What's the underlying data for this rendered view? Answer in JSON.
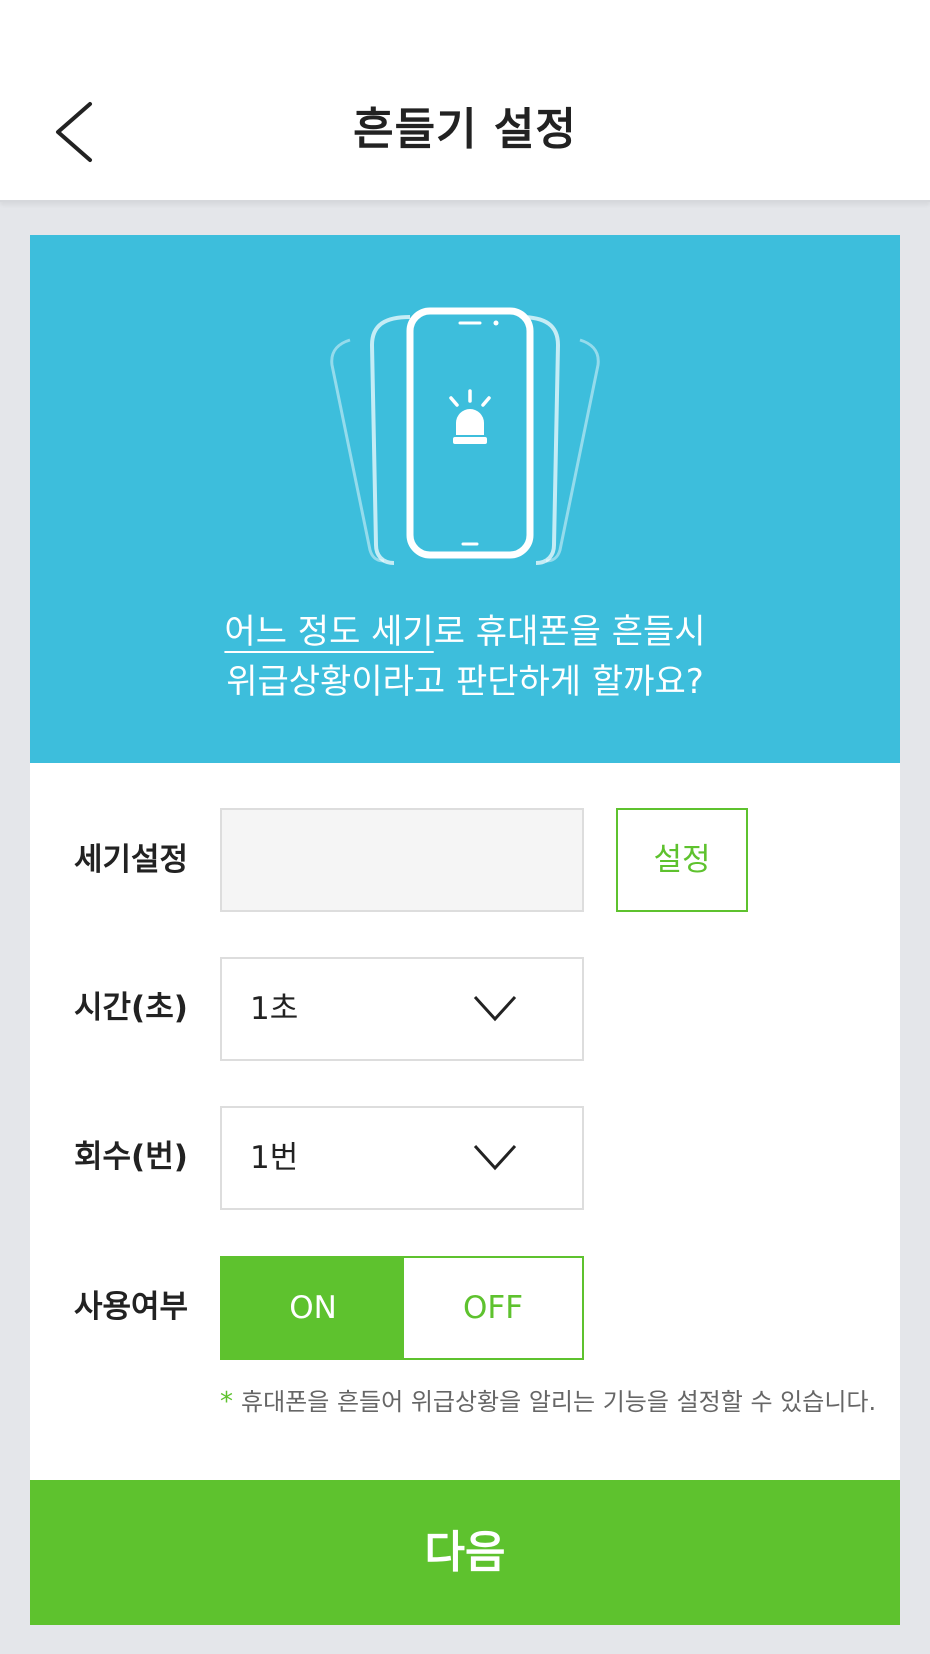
{
  "header": {
    "title": "흔들기 설정",
    "back_icon": "chevron-left-icon"
  },
  "hero": {
    "illustration_icon": "shaking-phone-alarm-icon",
    "line1_underlined": "어느 정도 세기",
    "line1_rest": "로 휴대폰을 흔들시",
    "line2": "위급상황이라고 판단하게 할까요?",
    "background_color": "#3dbedc"
  },
  "form": {
    "strength": {
      "label": "세기설정",
      "value": "",
      "button_label": "설정"
    },
    "time": {
      "label": "시간(초)",
      "selected": "1초",
      "icon": "chevron-down-icon"
    },
    "count": {
      "label": "회수(번)",
      "selected": "1번",
      "icon": "chevron-down-icon"
    },
    "enabled": {
      "label": "사용여부",
      "on_label": "ON",
      "off_label": "OFF",
      "selected": "ON"
    },
    "note_marker": "*",
    "note": "휴대폰을 흔들어 위급상황을 알리는 기능을 설정할 수 있습니다."
  },
  "footer": {
    "next_label": "다음",
    "accent_color": "#5ec22e"
  }
}
